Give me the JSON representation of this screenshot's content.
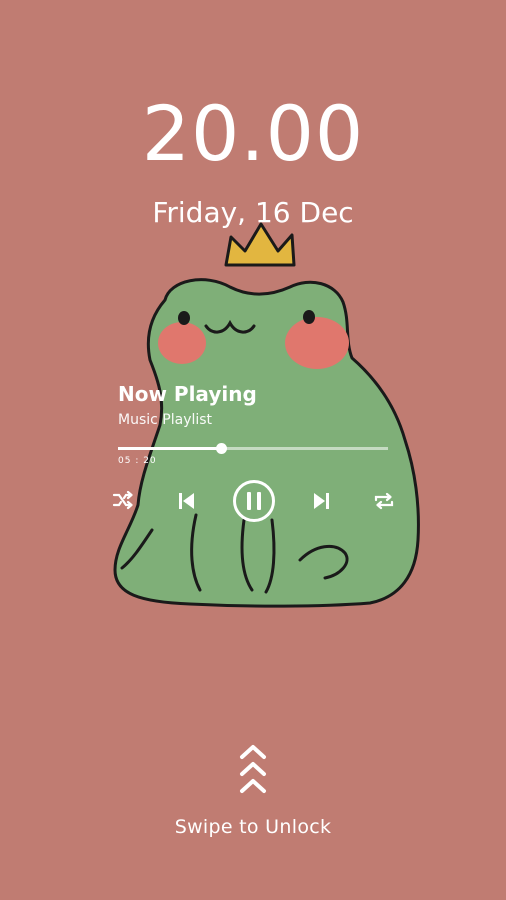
{
  "lockscreen": {
    "time": "20.00",
    "date": "Friday, 16 Dec",
    "wallpaper_icon": "crowned-frog"
  },
  "player": {
    "title": "Now Playing",
    "subtitle": "Music Playlist",
    "elapsed": "05 : 20",
    "progress_fraction": 0.38,
    "controls": {
      "shuffle_icon": "shuffle-icon",
      "previous_icon": "skip-previous-icon",
      "pause_icon": "pause-icon",
      "next_icon": "skip-next-icon",
      "repeat_icon": "repeat-icon"
    }
  },
  "unlock": {
    "label": "Swipe to Unlock",
    "icon": "chevrons-up-icon"
  },
  "colors": {
    "background": "#c07c72",
    "frog_body": "#7faf78",
    "cheek": "#e0776d",
    "crown": "#e2b640",
    "foreground": "#ffffff"
  }
}
